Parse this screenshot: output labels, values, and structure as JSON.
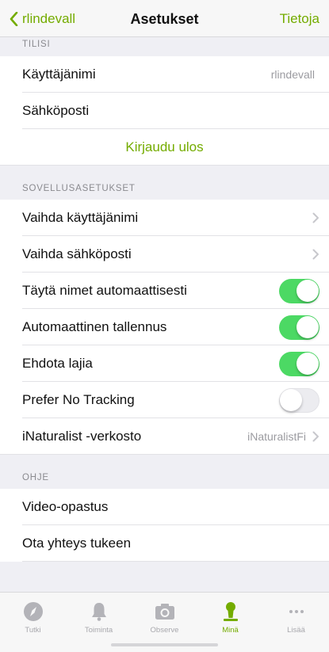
{
  "nav": {
    "back_label": "rlindevall",
    "title": "Asetukset",
    "right_label": "Tietoja"
  },
  "account": {
    "header": "TILISI",
    "username_label": "Käyttäjänimi",
    "username_value": "rlindevall",
    "email_label": "Sähköposti",
    "logout_label": "Kirjaudu ulos"
  },
  "app_settings": {
    "header": "SOVELLUSASETUKSET",
    "change_username": "Vaihda käyttäjänimi",
    "change_email": "Vaihda sähköposti",
    "autocomplete_names": {
      "label": "Täytä nimet automaattisesti",
      "on": true
    },
    "autosave": {
      "label": "Automaattinen tallennus",
      "on": true
    },
    "suggest_species": {
      "label": "Ehdota lajia",
      "on": true
    },
    "prefer_no_tracking": {
      "label": "Prefer No Tracking",
      "on": false
    },
    "network_label": "iNaturalist -verkosto",
    "network_value": "iNaturalistFi"
  },
  "help": {
    "header": "OHJE",
    "video_tutorial": "Video-opastus",
    "contact_support": "Ota yhteys tukeen"
  },
  "tabbar": {
    "items": [
      {
        "label": "Tutki",
        "icon": "compass-icon"
      },
      {
        "label": "Toiminta",
        "icon": "bell-icon"
      },
      {
        "label": "Observe",
        "icon": "camera-icon"
      },
      {
        "label": "Minä",
        "icon": "person-icon"
      },
      {
        "label": "Lisää",
        "icon": "more-icon"
      }
    ]
  },
  "colors": {
    "accent": "#74ac00",
    "toggle_on": "#4cd964",
    "background": "#efeff4"
  }
}
